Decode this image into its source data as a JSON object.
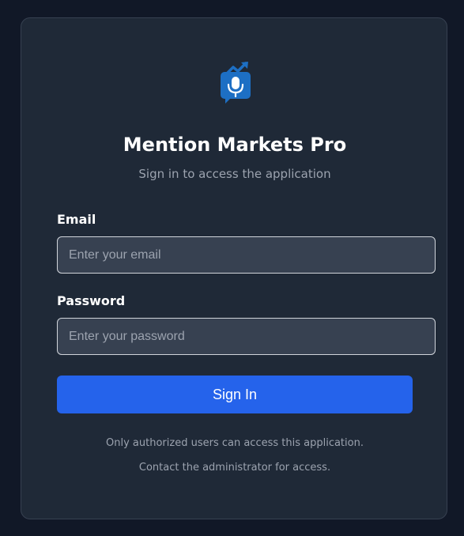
{
  "app": {
    "title": "Mention Markets Pro",
    "subtitle": "Sign in to access the application",
    "logo_icon": "mic-chart-logo-icon"
  },
  "form": {
    "email_label": "Email",
    "email_placeholder": "Enter your email",
    "email_value": "",
    "password_label": "Password",
    "password_placeholder": "Enter your password",
    "password_value": "",
    "submit_label": "Sign In"
  },
  "footer": {
    "line1": "Only authorized users can access this application.",
    "line2": "Contact the administrator for access."
  },
  "colors": {
    "background": "#111827",
    "card": "#1f2937",
    "input": "#374151",
    "accent": "#2563eb",
    "logo": "#1d6fc4"
  }
}
